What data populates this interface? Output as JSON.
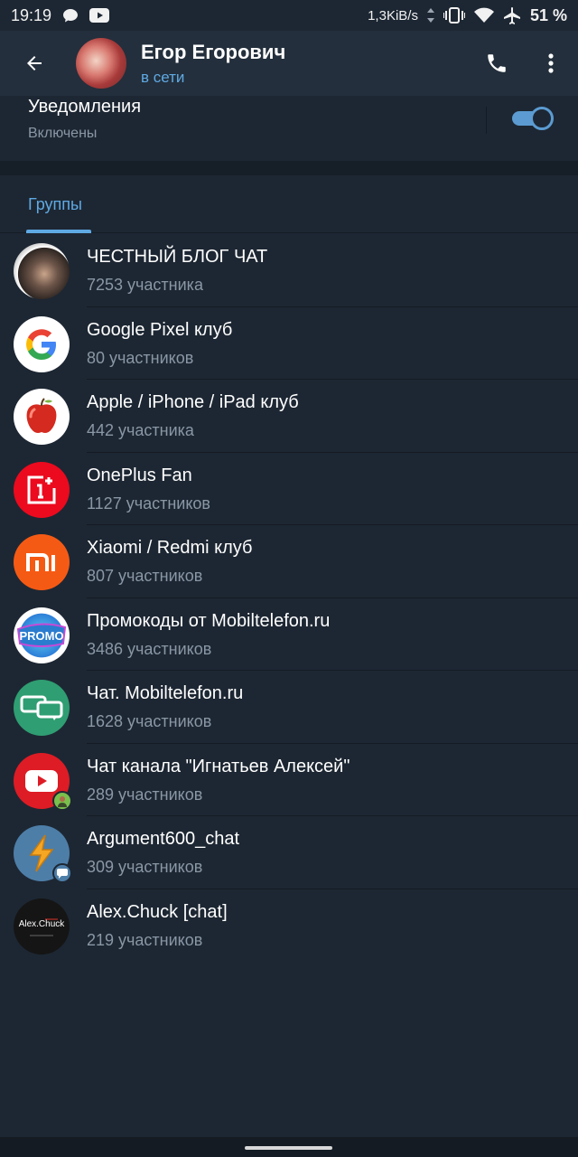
{
  "status_bar": {
    "time": "19:19",
    "speed": "1,3KiB/s",
    "battery": "51 %",
    "icons": [
      "message-icon",
      "youtube-icon",
      "vibrate-icon",
      "wifi-icon",
      "airplane-icon"
    ]
  },
  "header": {
    "name": "Егор Егорович",
    "status": "в сети",
    "status_color": "#5fa9e3"
  },
  "notifications": {
    "label": "Уведомления",
    "value": "Включены",
    "enabled": true
  },
  "tabs": [
    {
      "label": "Группы",
      "active": true
    }
  ],
  "groups": [
    {
      "name": "ЧЕСТНЫЙ БЛОГ ЧАТ",
      "count": "7253 участника",
      "avatar": "person-photo"
    },
    {
      "name": "Google Pixel клуб",
      "count": "80 участников",
      "avatar": "google-logo"
    },
    {
      "name": "Apple / iPhone / iPad клуб",
      "count": "442 участника",
      "avatar": "apple-photo"
    },
    {
      "name": "OnePlus Fan",
      "count": "1127 участников",
      "avatar": "oneplus-logo"
    },
    {
      "name": "Xiaomi / Redmi клуб",
      "count": "807 участников",
      "avatar": "xiaomi-logo"
    },
    {
      "name": "Промокоды от Mobiltelefon.ru",
      "count": "3486 участников",
      "avatar": "promo-logo",
      "avatar_text": "PROMO"
    },
    {
      "name": "Чат. Mobiltelefon.ru",
      "count": "1628 участников",
      "avatar": "chat-bubbles-logo"
    },
    {
      "name": "Чат канала \"Игнатьев Алексей\"",
      "count": "289 участников",
      "avatar": "youtube-logo"
    },
    {
      "name": "Argument600_chat",
      "count": "309 участников",
      "avatar": "lightning-logo"
    },
    {
      "name": "Alex.Chuck [chat]",
      "count": "219 участников",
      "avatar": "alexchuck-logo",
      "avatar_text": "Alex.Chuck"
    }
  ]
}
